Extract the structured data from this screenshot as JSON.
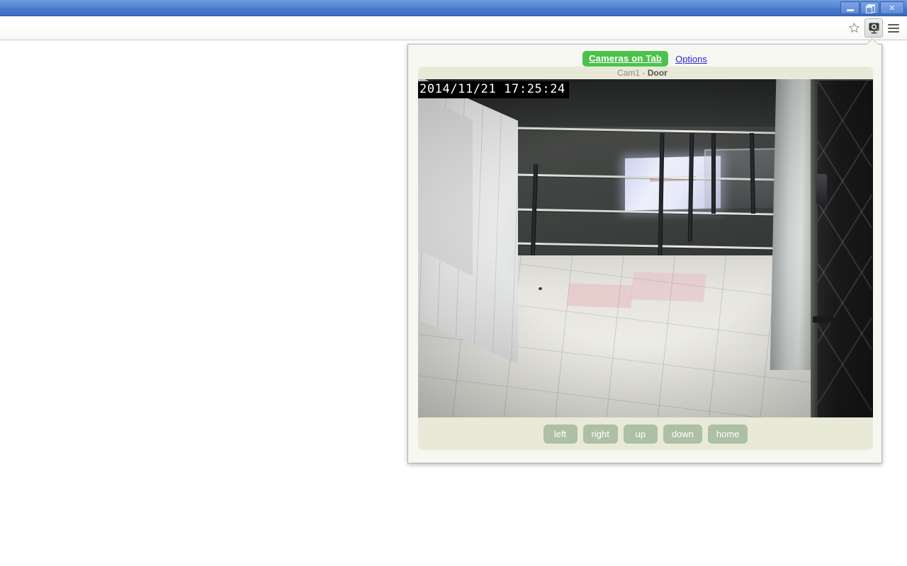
{
  "window": {
    "buttons": [
      {
        "name": "minimize",
        "label": "–"
      },
      {
        "name": "restore",
        "label": "❐"
      },
      {
        "name": "close",
        "label": "✕"
      }
    ]
  },
  "toolbar": {
    "bookmark_icon": "star-icon",
    "extension_icon": "camera-icon",
    "menu_icon": "hamburger-menu-icon"
  },
  "popup": {
    "tab_label": "Cameras on Tab",
    "options_label": "Options",
    "accent_green": "#4cc24c",
    "link_blue": "#2a2ad0",
    "card_bg": "#e9e9d8",
    "button_bg": "#adbfa5",
    "camera": {
      "id": "Cam1",
      "separator": "-",
      "name": "Door",
      "timestamp": "2014/11/21 17:25:24"
    },
    "controls": [
      {
        "name": "left",
        "label": "left"
      },
      {
        "name": "right",
        "label": "right"
      },
      {
        "name": "up",
        "label": "up"
      },
      {
        "name": "down",
        "label": "down"
      },
      {
        "name": "home",
        "label": "home"
      }
    ]
  }
}
